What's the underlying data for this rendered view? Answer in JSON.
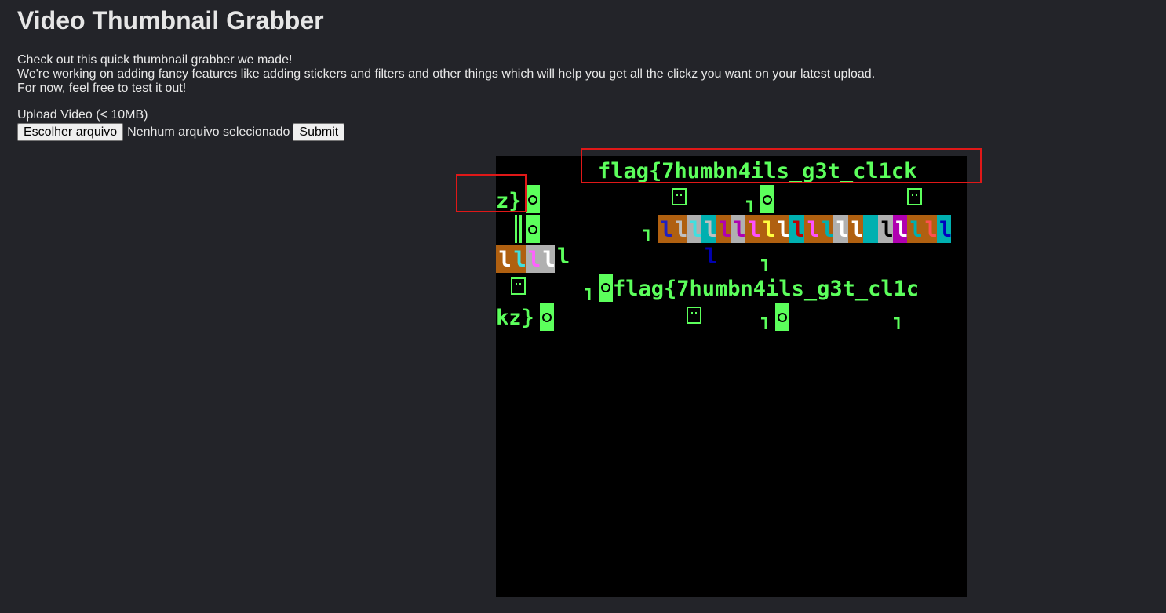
{
  "page": {
    "title": "Video Thumbnail Grabber",
    "intro": [
      "Check out this quick thumbnail grabber we made!",
      "We're working on adding fancy features like adding stickers and filters and other things which will help you get all the clickz you want on your latest upload.",
      "For now, feel free to test it out!"
    ]
  },
  "form": {
    "upload_label": "Upload Video (< 10MB)",
    "choose_file_label": "Escolher arquivo",
    "file_status": "Nenhum arquivo selecionado",
    "submit_label": "Submit"
  },
  "thumbnail": {
    "line1": "flag{7humbn4ils_g3t_cl1ck",
    "line2": "z}",
    "line3": "flag{7humbn4ils_g3t_cl1c",
    "line4": "kz}",
    "accent": "#5cff5c",
    "highlight_color": "#e01818"
  }
}
